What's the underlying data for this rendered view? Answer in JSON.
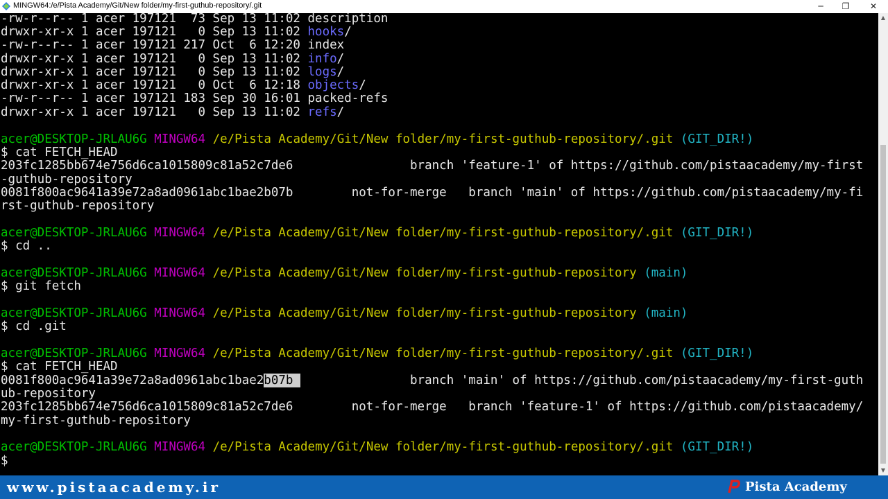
{
  "window": {
    "title": "MINGW64:/e/Pista Academy/Git/New folder/my-first-guthub-repository/.git",
    "minimize": "─",
    "restore": "❐",
    "close": "✕"
  },
  "terminal": {
    "ls": [
      {
        "perm": "-rw-r--r--",
        "n": "1",
        "user": "acer",
        "group": "197121",
        "size": " 73",
        "date": "Sep 13 11:02",
        "name": "description",
        "dir": false
      },
      {
        "perm": "drwxr-xr-x",
        "n": "1",
        "user": "acer",
        "group": "197121",
        "size": "  0",
        "date": "Sep 13 11:02",
        "name": "hooks/",
        "dir": true
      },
      {
        "perm": "-rw-r--r--",
        "n": "1",
        "user": "acer",
        "group": "197121",
        "size": "217",
        "date": "Oct  6 12:20",
        "name": "index",
        "dir": false
      },
      {
        "perm": "drwxr-xr-x",
        "n": "1",
        "user": "acer",
        "group": "197121",
        "size": "  0",
        "date": "Sep 13 11:02",
        "name": "info/",
        "dir": true
      },
      {
        "perm": "drwxr-xr-x",
        "n": "1",
        "user": "acer",
        "group": "197121",
        "size": "  0",
        "date": "Sep 13 11:02",
        "name": "logs/",
        "dir": true
      },
      {
        "perm": "drwxr-xr-x",
        "n": "1",
        "user": "acer",
        "group": "197121",
        "size": "  0",
        "date": "Oct  6 12:18",
        "name": "objects/",
        "dir": true
      },
      {
        "perm": "-rw-r--r--",
        "n": "1",
        "user": "acer",
        "group": "197121",
        "size": "183",
        "date": "Sep 30 16:01",
        "name": "packed-refs",
        "dir": false
      },
      {
        "perm": "drwxr-xr-x",
        "n": "1",
        "user": "acer",
        "group": "197121",
        "size": "  0",
        "date": "Sep 13 11:02",
        "name": "refs/",
        "dir": true
      }
    ],
    "prompt": {
      "userhost": "acer@DESKTOP-JRLAU6G",
      "mingw": "MINGW64",
      "path_git": "/e/Pista Academy/Git/New folder/my-first-guthub-repository/.git",
      "path_repo": "/e/Pista Academy/Git/New folder/my-first-guthub-repository",
      "gitdir": "(GIT_DIR!)",
      "main": "(main)",
      "dollar": "$"
    },
    "cmd1": "$ cat FETCH_HEAD",
    "fh1_a": "203fc1285bb674e756d6ca1015809c81a52c7de6                branch 'feature-1' of https://github.com/pistaacademy/my-first",
    "fh1_b": "-guthub-repository",
    "fh1_c": "0081f800ac9641a39e72a8ad0961abc1bae2b07b        not-for-merge   branch 'main' of https://github.com/pistaacademy/my-fi",
    "fh1_d": "rst-guthub-repository",
    "cmd2": "$ cd ..",
    "cmd3": "$ git fetch",
    "cmd4": "$ cd .git",
    "cmd5": "$ cat FETCH_HEAD",
    "fh2_hash_pre": "0081f800ac9641a39e72a8ad0961abc1bae2",
    "fh2_hash_sel": "b07b ",
    "fh2_a_rest": "               branch 'main' of https://github.com/pistaacademy/my-first-guth",
    "fh2_b": "ub-repository",
    "fh2_c": "203fc1285bb674e756d6ca1015809c81a52c7de6        not-for-merge   branch 'feature-1' of https://github.com/pistaacademy/",
    "fh2_d": "my-first-guthub-repository",
    "final": "$"
  },
  "footer": {
    "site": "www.pistaacademy.ir",
    "brand": "Pista Academy"
  }
}
